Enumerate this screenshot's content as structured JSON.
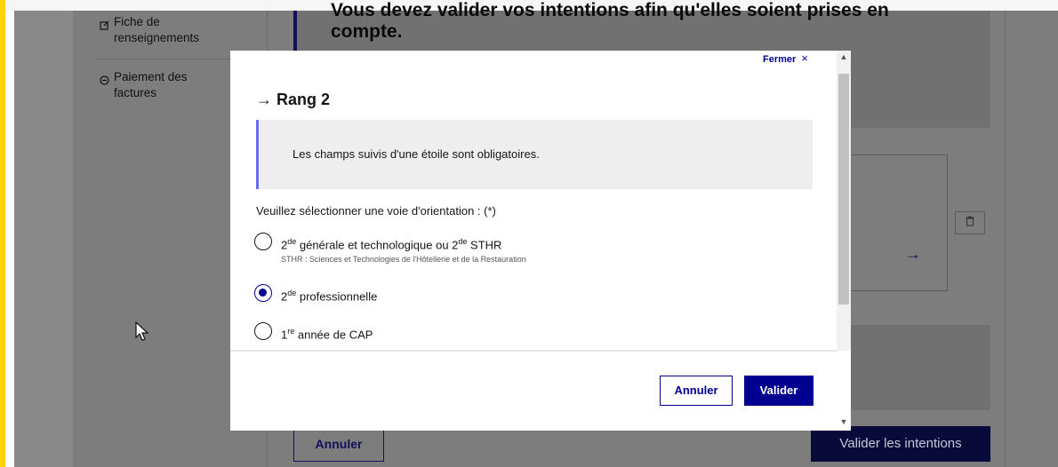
{
  "sidebar": {
    "items": [
      {
        "icon": "edit-icon",
        "label_line1": "Fiche de",
        "label_line2": "renseignements"
      },
      {
        "icon": "payment-icon",
        "label_line1": "Paiement des",
        "label_line2": "factures"
      }
    ]
  },
  "background": {
    "card_line1": "Vous devez valider vos intentions afin qu'elles soient prises en",
    "card_line2": "compte.",
    "cancel_label": "Annuler",
    "validate_label": "Valider les intentions",
    "arrow": "→",
    "trash_icon": "trash-icon"
  },
  "modal": {
    "close_label": "Fermer",
    "close_glyph": "×",
    "title": "→ Rang 2",
    "notice": "Les champs suivis d'une étoile sont obligatoires.",
    "legend": "Veuillez sélectionner une voie d'orientation : (*)",
    "options": [
      {
        "label_pre": "2",
        "label_sup": "de",
        "label_post": " générale et technologique ou 2",
        "label_sup2": "de",
        "label_post2": " STHR",
        "hint": "STHR : Sciences et Technologies de l'Hôtellerie et de la Restauration",
        "checked": false
      },
      {
        "label_pre": "2",
        "label_sup": "de",
        "label_post": " professionnelle",
        "checked": true
      },
      {
        "label_pre": "1",
        "label_sup": "re",
        "label_post": " année de CAP",
        "checked": false
      }
    ],
    "cancel_label": "Annuler",
    "validate_label": "Valider"
  },
  "colors": {
    "accent": "#000091",
    "marianne_yellow": "#fcd200",
    "notice_border": "#6a6af4"
  }
}
